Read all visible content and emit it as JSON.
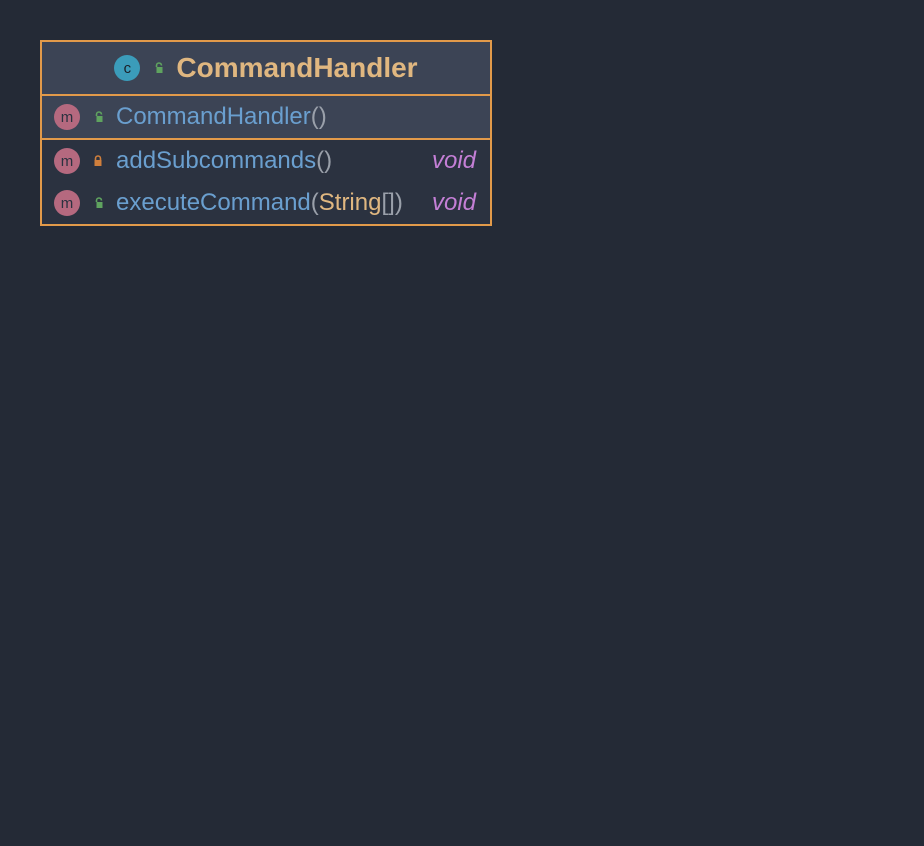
{
  "class": {
    "kind_icon_letter": "c",
    "visibility": "public",
    "name": "CommandHandler"
  },
  "members": [
    {
      "kind_icon_letter": "m",
      "visibility": "public",
      "name": "CommandHandler",
      "params_open": "(",
      "params_text": "",
      "params_close": ")",
      "return": "",
      "highlight": true
    },
    {
      "kind_icon_letter": "m",
      "visibility": "private",
      "name": "addSubcommands",
      "params_open": "(",
      "params_text": "",
      "params_close": ")",
      "return": "void",
      "highlight": false
    },
    {
      "kind_icon_letter": "m",
      "visibility": "public",
      "name": "executeCommand",
      "params_open": "(",
      "param_type": "String",
      "param_suffix": "[]",
      "params_close": ")",
      "return": "void",
      "highlight": false
    }
  ]
}
